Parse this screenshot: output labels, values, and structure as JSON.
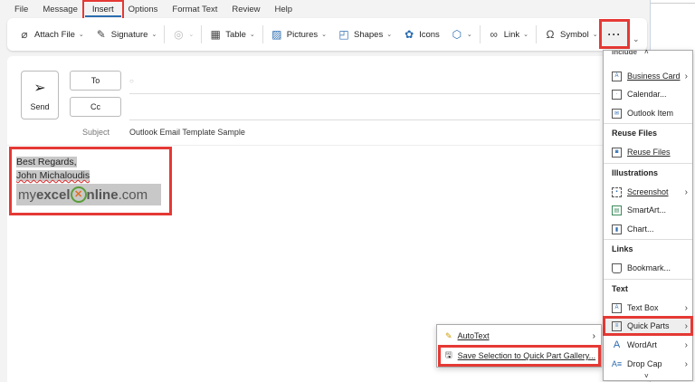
{
  "tabs": [
    "File",
    "Message",
    "Insert",
    "Options",
    "Format Text",
    "Review",
    "Help"
  ],
  "ribbon": {
    "attach": "Attach File",
    "signature": "Signature",
    "table": "Table",
    "pictures": "Pictures",
    "shapes": "Shapes",
    "icons": "Icons",
    "link": "Link",
    "symbol": "Symbol",
    "more": "···"
  },
  "compose": {
    "send": "Send",
    "to": "To",
    "cc": "Cc",
    "subject_label": "Subject",
    "subject": "Outlook Email Template Sample"
  },
  "signature": {
    "line1": "Best Regards,",
    "line2": "John Michaloudis",
    "logo": "myexcelOnline.com"
  },
  "menu": {
    "include": "Include",
    "business_card": "Business Card",
    "calendar": "Calendar...",
    "outlook_item": "Outlook Item",
    "reuse_head": "Reuse Files",
    "reuse": "Reuse Files",
    "illus_head": "Illustrations",
    "screenshot": "Screenshot",
    "smartart": "SmartArt...",
    "chart": "Chart...",
    "links_head": "Links",
    "bookmark": "Bookmark...",
    "text_head": "Text",
    "textbox": "Text Box",
    "quickparts": "Quick Parts",
    "wordart": "WordArt",
    "dropcap": "Drop Cap"
  },
  "submenu": {
    "autotext": "AutoText",
    "save": "Save Selection to Quick Part Gallery..."
  },
  "colors": {
    "highlight": "#e53935",
    "accent": "#2b6cb0"
  }
}
